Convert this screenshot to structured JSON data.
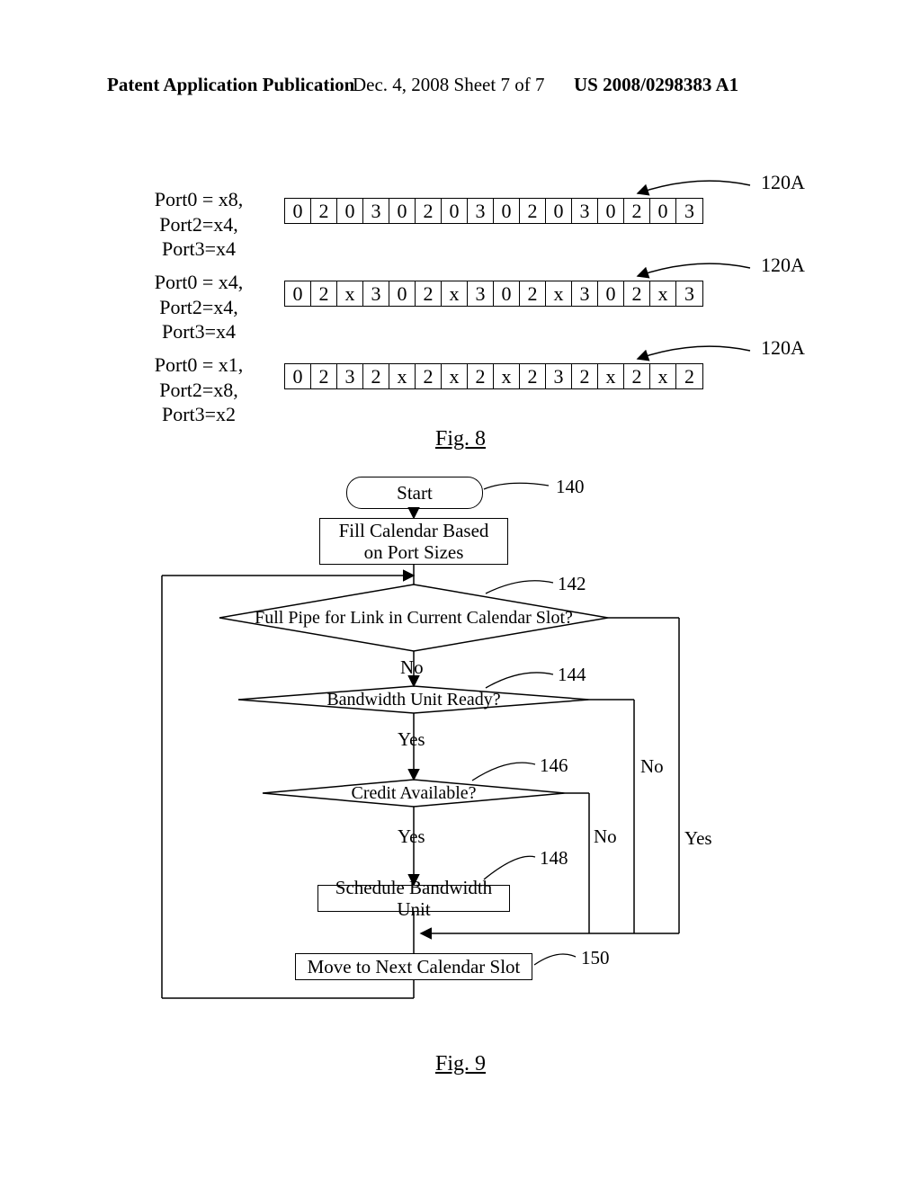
{
  "header": {
    "left": "Patent Application Publication",
    "mid": "Dec. 4, 2008  Sheet 7 of 7",
    "right": "US 2008/0298383 A1"
  },
  "fig8": {
    "caption": "Fig. 8",
    "callout_ref": "120A",
    "rows": [
      {
        "config_line1": "Port0 = x8,",
        "config_line2": "Port2=x4, Port3=x4",
        "cells": [
          "0",
          "2",
          "0",
          "3",
          "0",
          "2",
          "0",
          "3",
          "0",
          "2",
          "0",
          "3",
          "0",
          "2",
          "0",
          "3"
        ]
      },
      {
        "config_line1": "Port0 = x4,",
        "config_line2": "Port2=x4, Port3=x4",
        "cells": [
          "0",
          "2",
          "x",
          "3",
          "0",
          "2",
          "x",
          "3",
          "0",
          "2",
          "x",
          "3",
          "0",
          "2",
          "x",
          "3"
        ]
      },
      {
        "config_line1": "Port0 = x1,",
        "config_line2": "Port2=x8, Port3=x2",
        "cells": [
          "0",
          "2",
          "3",
          "2",
          "x",
          "2",
          "x",
          "2",
          "x",
          "2",
          "3",
          "2",
          "x",
          "2",
          "x",
          "2"
        ]
      }
    ]
  },
  "fig9": {
    "caption": "Fig. 9",
    "start": "Start",
    "step140": "Fill Calendar Based on Port Sizes",
    "step142": "Full Pipe for Link in Current Calendar Slot?",
    "step144": "Bandwidth Unit Ready?",
    "step146": "Credit Available?",
    "step148": "Schedule Bandwidth Unit",
    "step150": "Move to Next Calendar Slot",
    "ref140": "140",
    "ref142": "142",
    "ref144": "144",
    "ref146": "146",
    "ref148": "148",
    "ref150": "150",
    "yes": "Yes",
    "no": "No"
  }
}
